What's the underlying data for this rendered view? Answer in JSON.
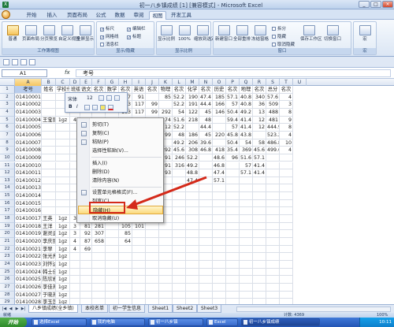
{
  "window": {
    "title": "初一八乡镇成绩 [1] [兼容模式] - Microsoft Excel",
    "minimize": "_",
    "maximize": "□",
    "close": "×"
  },
  "tabs": [
    "开始",
    "插入",
    "页面布局",
    "公式",
    "数据",
    "审阅",
    "视图",
    "开发工具"
  ],
  "ribbon": {
    "group1": {
      "name": "工作簿视图",
      "buttons": [
        "普通",
        "页面布局",
        "分页预览",
        "自定义视图",
        "全屏显示"
      ]
    },
    "group2": {
      "name": "显示/隐藏",
      "checks": [
        {
          "label": "标尺",
          "checked": true
        },
        {
          "label": "网格线",
          "checked": true
        },
        {
          "label": "消息栏",
          "checked": false
        },
        {
          "label": "编辑栏",
          "checked": true
        },
        {
          "label": "标题",
          "checked": true
        }
      ]
    },
    "group3": {
      "name": "显示比例",
      "buttons": [
        "显示比例",
        "100%",
        "缩放到选定区域"
      ]
    },
    "group4": {
      "name": "窗口",
      "buttons": [
        "新建窗口",
        "全部重排",
        "冻结窗格",
        "保存工作区",
        "切换窗口"
      ],
      "small": [
        "拆分",
        "隐藏",
        "取消隐藏"
      ]
    },
    "group5": {
      "name": "宏",
      "buttons": [
        "宏"
      ]
    }
  },
  "formula_bar": {
    "name_box": "A1",
    "fx": "fx",
    "value": "考号"
  },
  "columns": [
    "A",
    "B",
    "C",
    "D",
    "E",
    "F",
    "G",
    "H",
    "I",
    "J",
    "K",
    "L",
    "M",
    "N",
    "O",
    "P",
    "Q",
    "R",
    "S",
    "T",
    "U"
  ],
  "grid": {
    "headers": [
      "考号",
      "姓名",
      "学校代码",
      "班级",
      "语文",
      "名次",
      "数学",
      "名次",
      "英语",
      "名次",
      "物理",
      "名次",
      "化学",
      "名次",
      "历史",
      "名次",
      "地理",
      "名次",
      "总分",
      "名次"
    ],
    "rows": [
      {
        "n": 2,
        "c": [
          "01410001",
          "",
          "",
          "",
          "",
          "",
          "",
          "117",
          "91",
          "",
          "85",
          "52.2",
          "190",
          "47.4",
          "185",
          "57.1",
          "40.8",
          "340",
          "57.6",
          "4"
        ]
      },
      {
        "n": 3,
        "c": [
          "01410002",
          "",
          "",
          "",
          "",
          "",
          "",
          "103",
          "117",
          "99",
          "",
          "52.2",
          "191",
          "44.4",
          "166",
          "57",
          "40.8",
          "36",
          "509",
          "3"
        ]
      },
      {
        "n": 4,
        "c": [
          "01410003",
          "",
          "",
          "",
          "",
          "",
          "",
          "103",
          "117",
          "99",
          "292",
          "54",
          "122",
          "45",
          "146",
          "50.4",
          "49.2",
          "13",
          "488",
          "8"
        ]
      },
      {
        "n": 5,
        "c": [
          "01410004",
          "王宝丽",
          "1gz",
          "4",
          "99",
          "71",
          "",
          "117",
          "98",
          "99",
          "274",
          "51.6",
          "218",
          "48",
          "",
          "59.4",
          "41.4",
          "12",
          "481",
          "9"
        ]
      },
      {
        "n": 6,
        "c": [
          "01410005",
          "",
          "",
          "",
          "",
          "",
          "",
          "98",
          "117",
          "96",
          "12",
          "52.2",
          "",
          "44.4",
          "",
          "57",
          "41.4",
          "12",
          "444.9",
          "8"
        ]
      },
      {
        "n": 7,
        "c": [
          "01410006",
          "",
          "",
          "",
          "",
          "",
          "",
          "5",
          "103",
          "117",
          "99",
          "48",
          "186",
          "45",
          "220",
          "45.8",
          "43.8",
          "",
          "523.2",
          "4"
        ]
      },
      {
        "n": 8,
        "c": [
          "01410007",
          "",
          "",
          "",
          "",
          "",
          "",
          "34",
          "98",
          "87",
          "",
          "49.2",
          "206",
          "39.6",
          "",
          "50.4",
          "54",
          "58",
          "486.8",
          "10"
        ]
      },
      {
        "n": 9,
        "c": [
          "01410008",
          "",
          "",
          "",
          "",
          "",
          "",
          "75",
          "623",
          "89",
          "292",
          "45.6",
          "308",
          "46.8",
          "418",
          "35.4",
          "369",
          "45.6",
          "499.6",
          "4"
        ]
      },
      {
        "n": 10,
        "c": [
          "01410009",
          "",
          "",
          "",
          "",
          "",
          "",
          "",
          "87",
          "420",
          "91",
          "246",
          "52.2",
          "",
          "48.6",
          "96",
          "51.6",
          "57.1",
          "",
          ""
        ]
      },
      {
        "n": 11,
        "c": [
          "01410010",
          "",
          "",
          "",
          "",
          "",
          "",
          "9",
          "78",
          "122",
          "91",
          "316",
          "49.2",
          "",
          "46.8",
          "",
          "57",
          "41.4",
          "",
          ""
        ]
      },
      {
        "n": 12,
        "c": [
          "01410011",
          "",
          "",
          "",
          "",
          "",
          "",
          "19",
          "89",
          "371",
          "93",
          "",
          "48.8",
          "",
          "47.4",
          "",
          "57.1",
          "41.4",
          "",
          ""
        ]
      },
      {
        "n": 13,
        "c": [
          "01410012",
          "",
          "",
          "",
          "",
          "",
          "",
          "",
          "117",
          "54",
          "",
          "",
          "47.4",
          "",
          "57.1",
          "",
          "",
          "",
          "",
          ""
        ]
      },
      {
        "n": 14,
        "c": [
          "01410013",
          "",
          "",
          "",
          "",
          "",
          "",
          "81",
          "86",
          "",
          "",
          "",
          "",
          "",
          "",
          "",
          "",
          "",
          "",
          ""
        ]
      },
      {
        "n": 15,
        "c": [
          "01410014",
          "",
          "",
          "",
          "",
          "",
          "",
          "",
          "105",
          "36",
          "",
          "",
          "",
          "",
          "",
          "",
          "",
          "",
          "",
          ""
        ]
      },
      {
        "n": 16,
        "c": [
          "01410015",
          "",
          "",
          "",
          "",
          "",
          "",
          "",
          "",
          "",
          "",
          "",
          "",
          "",
          "",
          "",
          "",
          "",
          "",
          ""
        ]
      },
      {
        "n": 17,
        "c": [
          "01410016",
          "",
          "",
          "",
          "",
          "",
          "",
          "100",
          "",
          "",
          "",
          "",
          "",
          "",
          "",
          "",
          "",
          "",
          "",
          ""
        ]
      },
      {
        "n": 18,
        "c": [
          "01410017",
          "王英",
          "1gz",
          "3",
          "63",
          "375",
          "",
          "105",
          "99",
          "",
          "",
          "",
          "",
          "",
          "",
          "",
          "",
          "",
          "",
          ""
        ]
      },
      {
        "n": 19,
        "c": [
          "01410018",
          "王洋",
          "1gz",
          "3",
          "81",
          "281",
          "",
          "105",
          "101",
          "",
          "",
          "",
          "",
          "",
          "",
          "",
          "",
          "",
          "",
          ""
        ]
      },
      {
        "n": 20,
        "c": [
          "01410019",
          "谢灵运",
          "1gz",
          "3",
          "92",
          "307",
          "",
          "85",
          "",
          "",
          "",
          "",
          "",
          "",
          "",
          "",
          "",
          "",
          "",
          ""
        ]
      },
      {
        "n": 21,
        "c": [
          "01410020",
          "李庆丽",
          "1gz",
          "4",
          "87",
          "658",
          "",
          "64",
          "",
          "",
          "",
          "",
          "",
          "",
          "",
          "",
          "",
          "",
          "",
          ""
        ]
      },
      {
        "n": 22,
        "c": [
          "01410021",
          "李翠",
          "1gz",
          "4",
          "69",
          "",
          "",
          "",
          "",
          "",
          "",
          "",
          "",
          "",
          "",
          "",
          "",
          "",
          "",
          ""
        ]
      },
      {
        "n": 23,
        "c": [
          "01410022",
          "张光亮",
          "1gz",
          "",
          "",
          "",
          "",
          "",
          "",
          "",
          "",
          "",
          "",
          "",
          "",
          "",
          "",
          "",
          "",
          ""
        ]
      },
      {
        "n": 24,
        "c": [
          "01410023",
          "刘怀达",
          "1gz",
          "",
          "",
          "",
          "",
          "",
          "",
          "",
          "",
          "",
          "",
          "",
          "",
          "",
          "",
          "",
          "",
          ""
        ]
      },
      {
        "n": 25,
        "c": [
          "01410024",
          "韩士佳",
          "1gz",
          "",
          "",
          "",
          "",
          "",
          "",
          "",
          "",
          "",
          "",
          "",
          "",
          "",
          "",
          "",
          "",
          ""
        ]
      },
      {
        "n": 26,
        "c": [
          "01410025",
          "陈欣岩",
          "1gz",
          "",
          "",
          "",
          "",
          "",
          "",
          "",
          "",
          "",
          "",
          "",
          "",
          "",
          "",
          "",
          "",
          ""
        ]
      },
      {
        "n": 27,
        "c": [
          "01410026",
          "李佳燕",
          "1gz",
          "",
          "",
          "",
          "",
          "",
          "",
          "",
          "",
          "",
          "",
          "",
          "",
          "",
          "",
          "",
          "",
          ""
        ]
      },
      {
        "n": 28,
        "c": [
          "01410027",
          "于晓燕",
          "1gz",
          "",
          "",
          "",
          "",
          "",
          "",
          "",
          "",
          "",
          "",
          "",
          "",
          "",
          "",
          "",
          "",
          ""
        ]
      },
      {
        "n": 29,
        "c": [
          "01410028",
          "李玉莲",
          "1gz",
          "",
          "",
          "",
          "",
          "",
          "",
          "",
          "",
          "",
          "",
          "",
          "",
          "",
          "",
          "",
          "",
          ""
        ]
      },
      {
        "n": 30,
        "c": [
          "01410029",
          "孔凡民",
          "刘梦平",
          "",
          "",
          "",
          "",
          "",
          "",
          "",
          "",
          "",
          "",
          "",
          "",
          "",
          "",
          "",
          "",
          ""
        ]
      }
    ]
  },
  "mini_toolbar": {
    "font": "宋体",
    "size": "12",
    "bold": "B",
    "italic": "I"
  },
  "context_menu": {
    "items": [
      "剪切(T)",
      "复制(C)",
      "粘贴(P)",
      "选择性粘贴(V)...",
      "插入(I)",
      "删除(D)",
      "清除内容(N)",
      "设置单元格格式(F)...",
      "列宽(C)...",
      "隐藏(H)",
      "取消隐藏(U)"
    ],
    "highlighted": "隐藏(H)"
  },
  "annotation": {
    "color": "#d42a1a"
  },
  "sheet_tabs": [
    "八乡镇成绩(全乡镇)",
    "本校名单",
    "初一学生信息",
    "Sheet1",
    "Sheet2",
    "Sheet3"
  ],
  "status": {
    "ready": "就绪",
    "count": "计数: 4369",
    "zoom": "100%"
  },
  "taskbar": {
    "start": "开始",
    "tasks": [
      "选择Excel",
      "我的电脑",
      "初一八乡镇",
      "Excel",
      "初一八乡镇成绩"
    ],
    "clock": "10:11"
  }
}
